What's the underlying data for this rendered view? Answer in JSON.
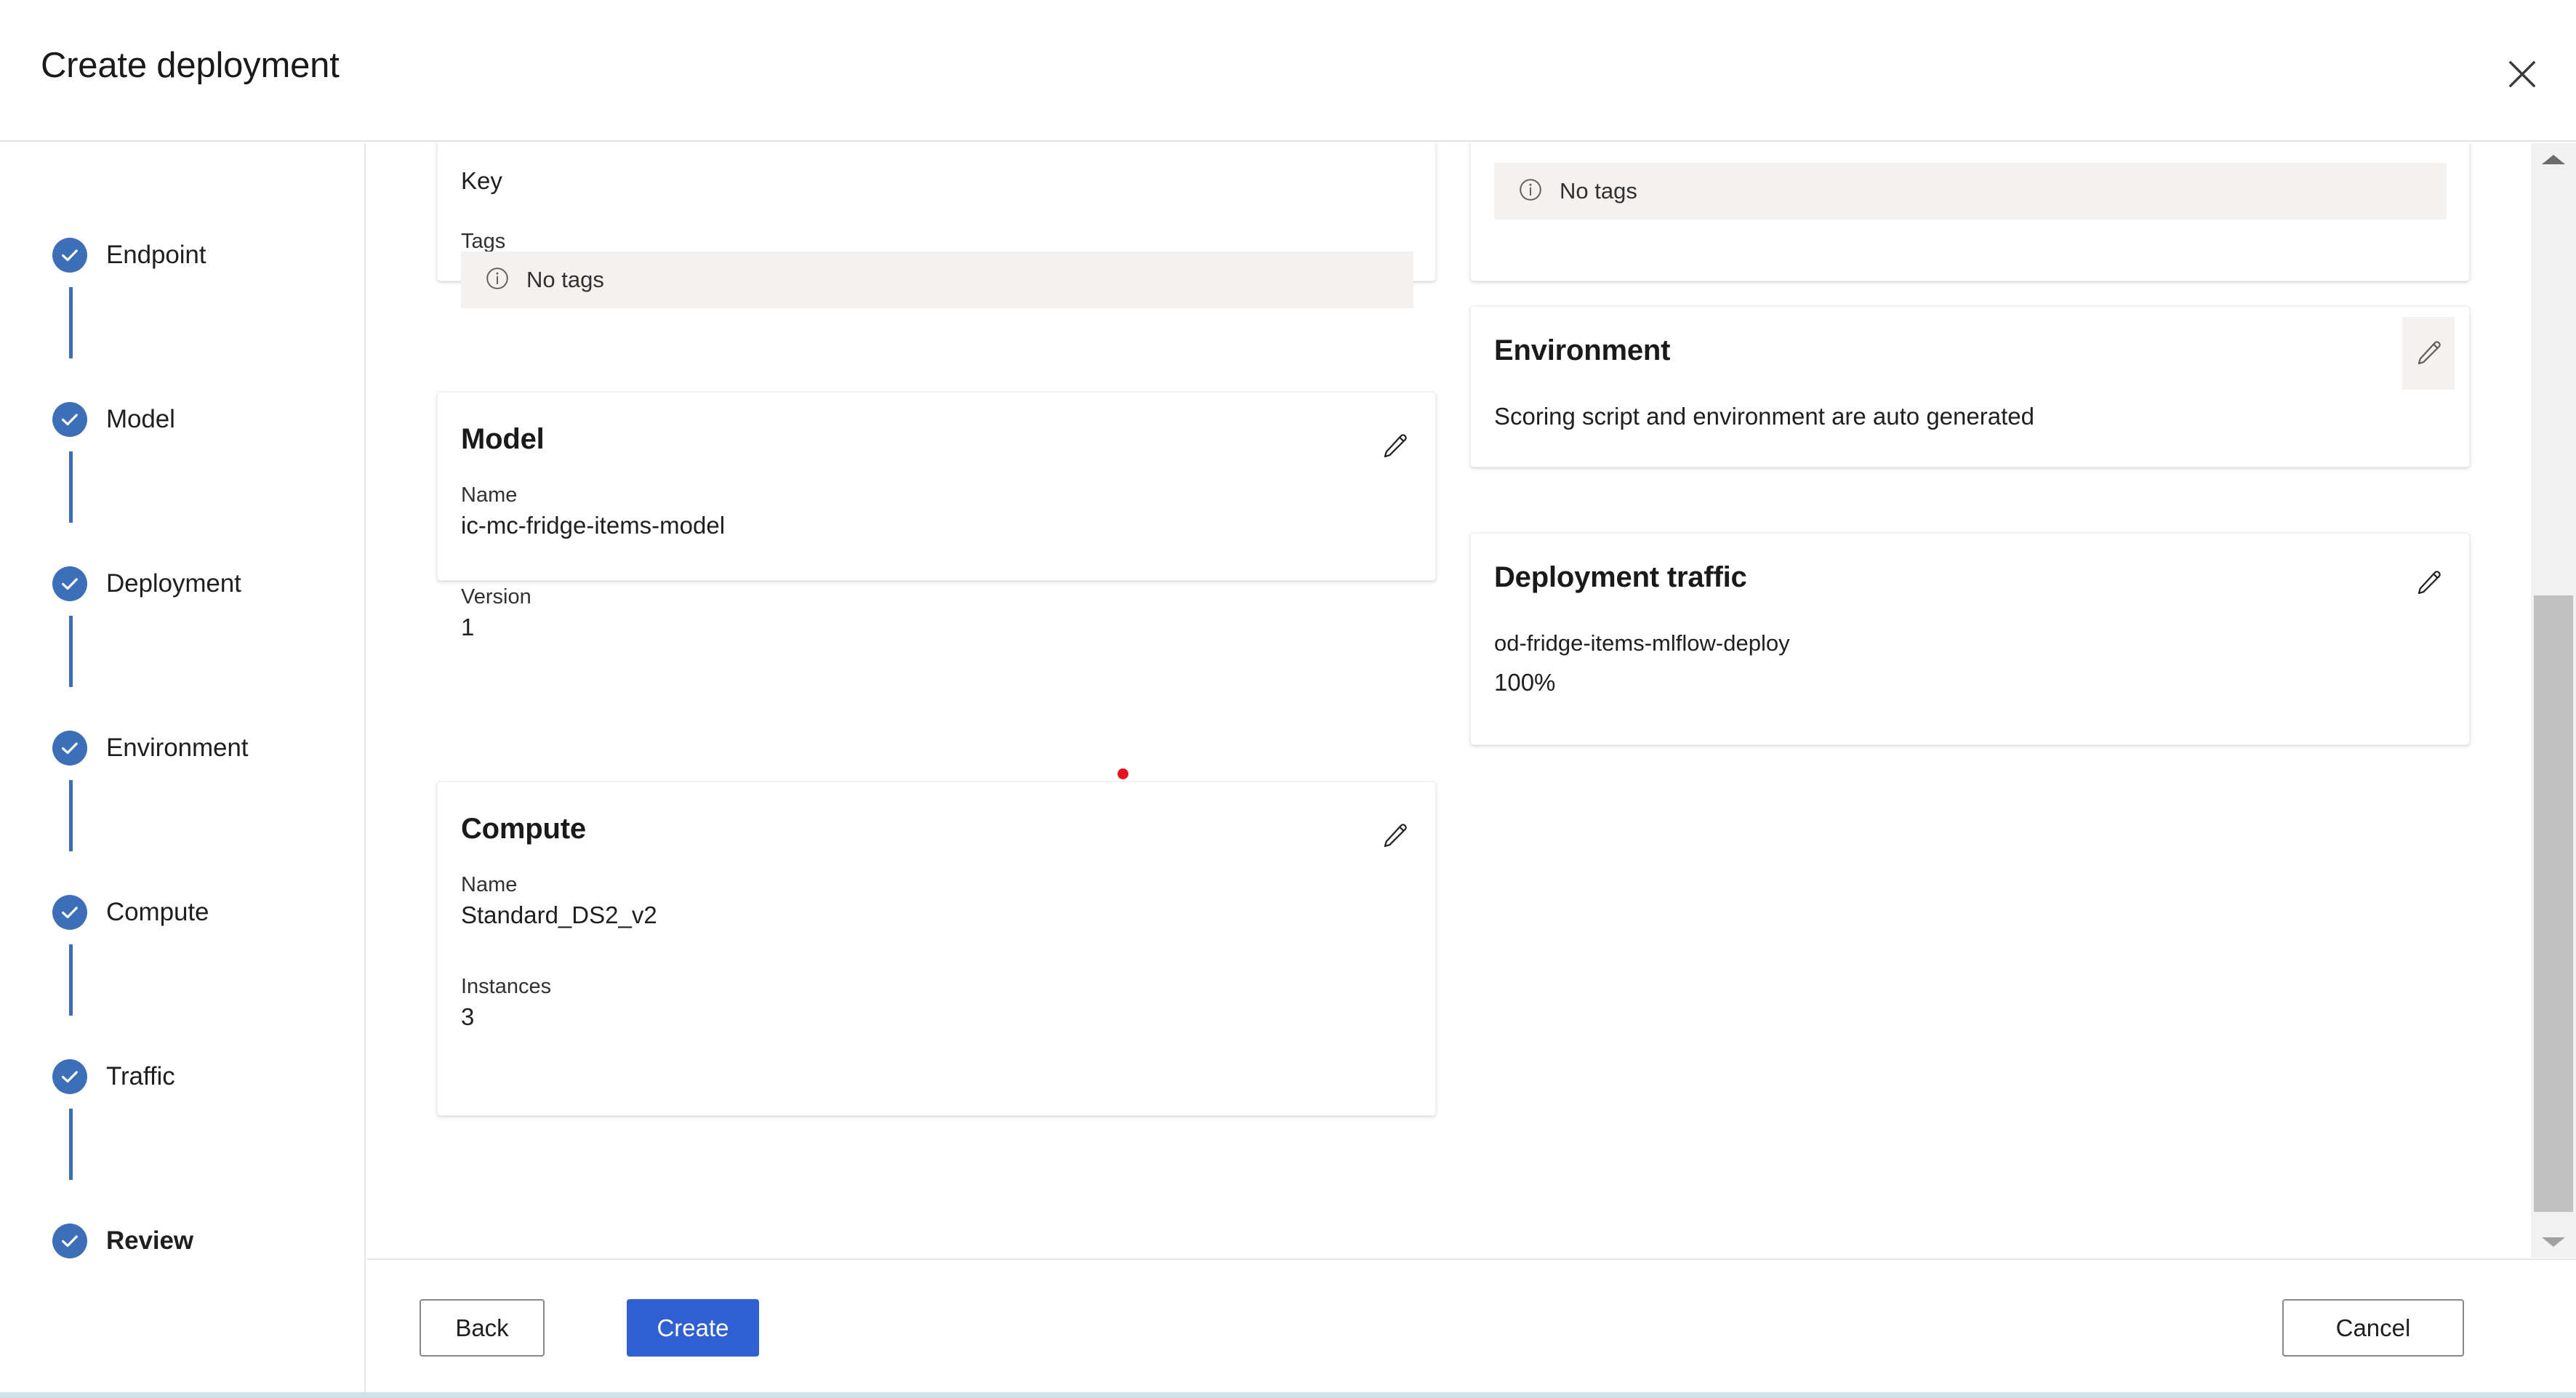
{
  "header": {
    "title": "Create deployment",
    "close_icon": "close-icon"
  },
  "wizard": {
    "steps": [
      {
        "label": "Endpoint",
        "state": "complete",
        "icon": "check-circle-icon"
      },
      {
        "label": "Model",
        "state": "complete",
        "icon": "check-circle-icon"
      },
      {
        "label": "Deployment",
        "state": "complete",
        "icon": "check-circle-icon"
      },
      {
        "label": "Environment",
        "state": "complete",
        "icon": "check-circle-icon"
      },
      {
        "label": "Compute",
        "state": "complete",
        "icon": "check-circle-icon"
      },
      {
        "label": "Traffic",
        "state": "complete",
        "icon": "check-circle-icon"
      },
      {
        "label": "Review",
        "state": "active",
        "icon": "check-circle-icon"
      }
    ]
  },
  "review": {
    "left_column": {
      "endpoint_card": {
        "clipped_label": "Key",
        "tags_label": "Tags",
        "tags_empty_text": "No tags",
        "tags_empty_icon": "info-circle-icon"
      },
      "model_card": {
        "title": "Model",
        "edit_icon": "pencil-icon",
        "name_label": "Name",
        "name_value": "ic-mc-fridge-items-model",
        "version_label": "Version",
        "version_value": "1"
      },
      "compute_card": {
        "title": "Compute",
        "edit_icon": "pencil-icon",
        "name_label": "Name",
        "name_value": "Standard_DS2_v2",
        "instances_label": "Instances",
        "instances_value": "3"
      }
    },
    "right_column": {
      "deployment_card": {
        "tags_empty_text": "No tags",
        "tags_empty_icon": "info-circle-icon"
      },
      "environment_card": {
        "title": "Environment",
        "edit_icon": "pencil-icon",
        "description": "Scoring script and environment are auto generated"
      },
      "traffic_card": {
        "title": "Deployment traffic",
        "edit_icon": "pencil-icon",
        "deployment_name": "od-fridge-items-mlflow-deploy",
        "traffic_percent": "100%"
      }
    }
  },
  "footer": {
    "back_label": "Back",
    "create_label": "Create",
    "cancel_label": "Cancel"
  },
  "scrollbar": {
    "up_icon": "chevron-up-icon",
    "down_icon": "chevron-down-icon"
  },
  "colors": {
    "accent_blue": "#3d6fb8",
    "primary_button": "#2f5fd0",
    "info_box_bg": "#f3f2f1",
    "cursor_marker": "#e81123"
  }
}
